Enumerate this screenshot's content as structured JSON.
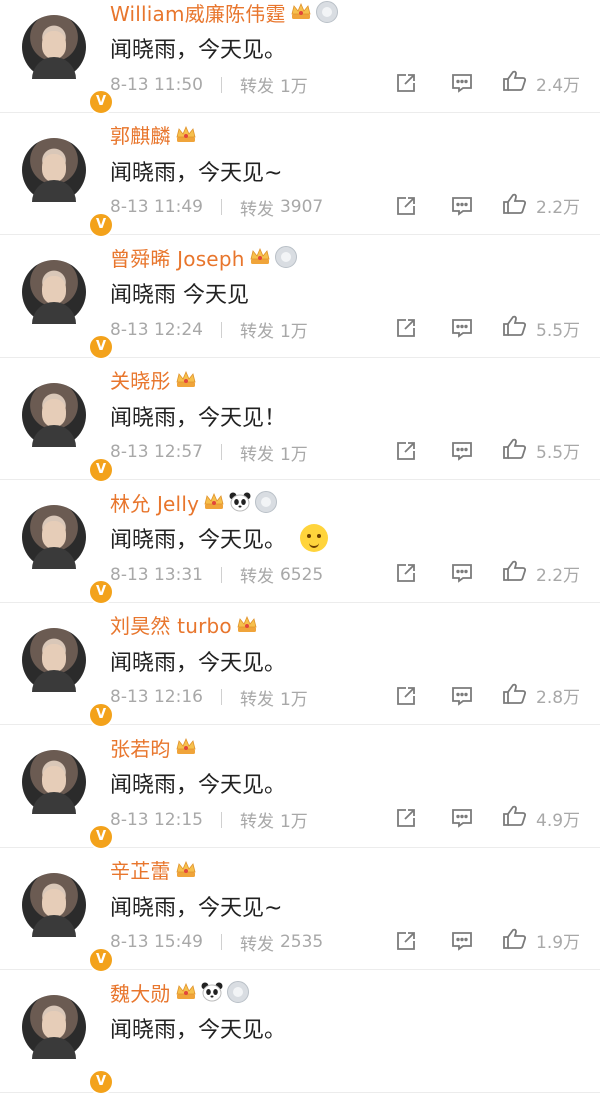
{
  "comments": [
    {
      "name": "William威廉陈伟霆",
      "text": "闻晓雨，今天见。",
      "time": "8-13 11:50",
      "forward_label": "转发",
      "forward_count": "1万",
      "likes": "2.4万",
      "badges": [
        "crown",
        "medal"
      ]
    },
    {
      "name": "郭麒麟",
      "text": "闻晓雨，今天见~",
      "time": "8-13 11:49",
      "forward_label": "转发",
      "forward_count": "3907",
      "likes": "2.2万",
      "badges": [
        "crown"
      ]
    },
    {
      "name": "曾舜晞 Joseph",
      "text": "闻晓雨 今天见",
      "time": "8-13 12:24",
      "forward_label": "转发",
      "forward_count": "1万",
      "likes": "5.5万",
      "badges": [
        "crown",
        "medal"
      ]
    },
    {
      "name": "关晓彤",
      "text": "闻晓雨，今天见！",
      "time": "8-13 12:57",
      "forward_label": "转发",
      "forward_count": "1万",
      "likes": "5.5万",
      "badges": [
        "crown"
      ]
    },
    {
      "name": "林允 Jelly",
      "text": "闻晓雨，今天见。",
      "time": "8-13 13:31",
      "forward_label": "转发",
      "forward_count": "6525",
      "likes": "2.2万",
      "badges": [
        "crown",
        "panda",
        "medal"
      ],
      "emoji": "smiling-face"
    },
    {
      "name": "刘昊然 turbo",
      "text": "闻晓雨，今天见。",
      "time": "8-13 12:16",
      "forward_label": "转发",
      "forward_count": "1万",
      "likes": "2.8万",
      "badges": [
        "crown"
      ]
    },
    {
      "name": "张若昀",
      "text": "闻晓雨，今天见。",
      "time": "8-13 12:15",
      "forward_label": "转发",
      "forward_count": "1万",
      "likes": "4.9万",
      "badges": [
        "crown"
      ]
    },
    {
      "name": "辛芷蕾",
      "text": "闻晓雨，今天见~",
      "time": "8-13 15:49",
      "forward_label": "转发",
      "forward_count": "2535",
      "likes": "1.9万",
      "badges": [
        "crown"
      ]
    },
    {
      "name": "魏大勋",
      "text": "闻晓雨，今天见。",
      "time": "",
      "forward_label": "",
      "forward_count": "",
      "likes": "",
      "badges": [
        "crown",
        "panda",
        "medal"
      ]
    }
  ],
  "verified_mark": "V",
  "icons": {
    "share": "share-icon",
    "comment": "comment-icon",
    "like": "thumbs-up-icon"
  },
  "colors": {
    "name": "#e8762d",
    "text": "#222222",
    "meta": "#a8a8a8",
    "verified": "#f3a21b"
  }
}
